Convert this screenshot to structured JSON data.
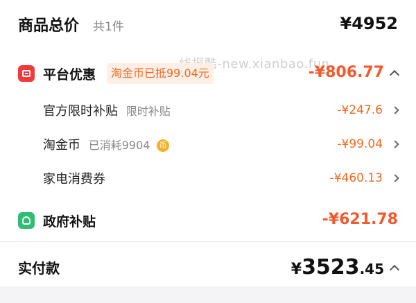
{
  "total": {
    "title": "商品总价",
    "count": "共1件",
    "amount": "¥4952"
  },
  "watermark": "线报酷-new.xianbao.fun",
  "platform": {
    "title": "平台优惠",
    "tag": "淘金币已抵99.04元",
    "amount": "-¥806.77",
    "items": [
      {
        "title": "官方限时补贴",
        "note": "限时补贴",
        "amount": "-¥247.6"
      },
      {
        "title": "淘金币",
        "note": "已消耗9904",
        "coin": "币",
        "amount": "-¥99.04"
      },
      {
        "title": "家电消费券",
        "note": "",
        "amount": "-¥460.13"
      }
    ]
  },
  "gov": {
    "title": "政府补贴",
    "amount": "-¥621.78"
  },
  "pay": {
    "title": "实付款",
    "currency": "¥",
    "integer": "3523",
    "decimal": ".45"
  },
  "colors": {
    "accent": "#f3592c",
    "badge_red": "#f23a3a",
    "gov_green": "#2ebd72",
    "coin": "#f3b12a"
  }
}
